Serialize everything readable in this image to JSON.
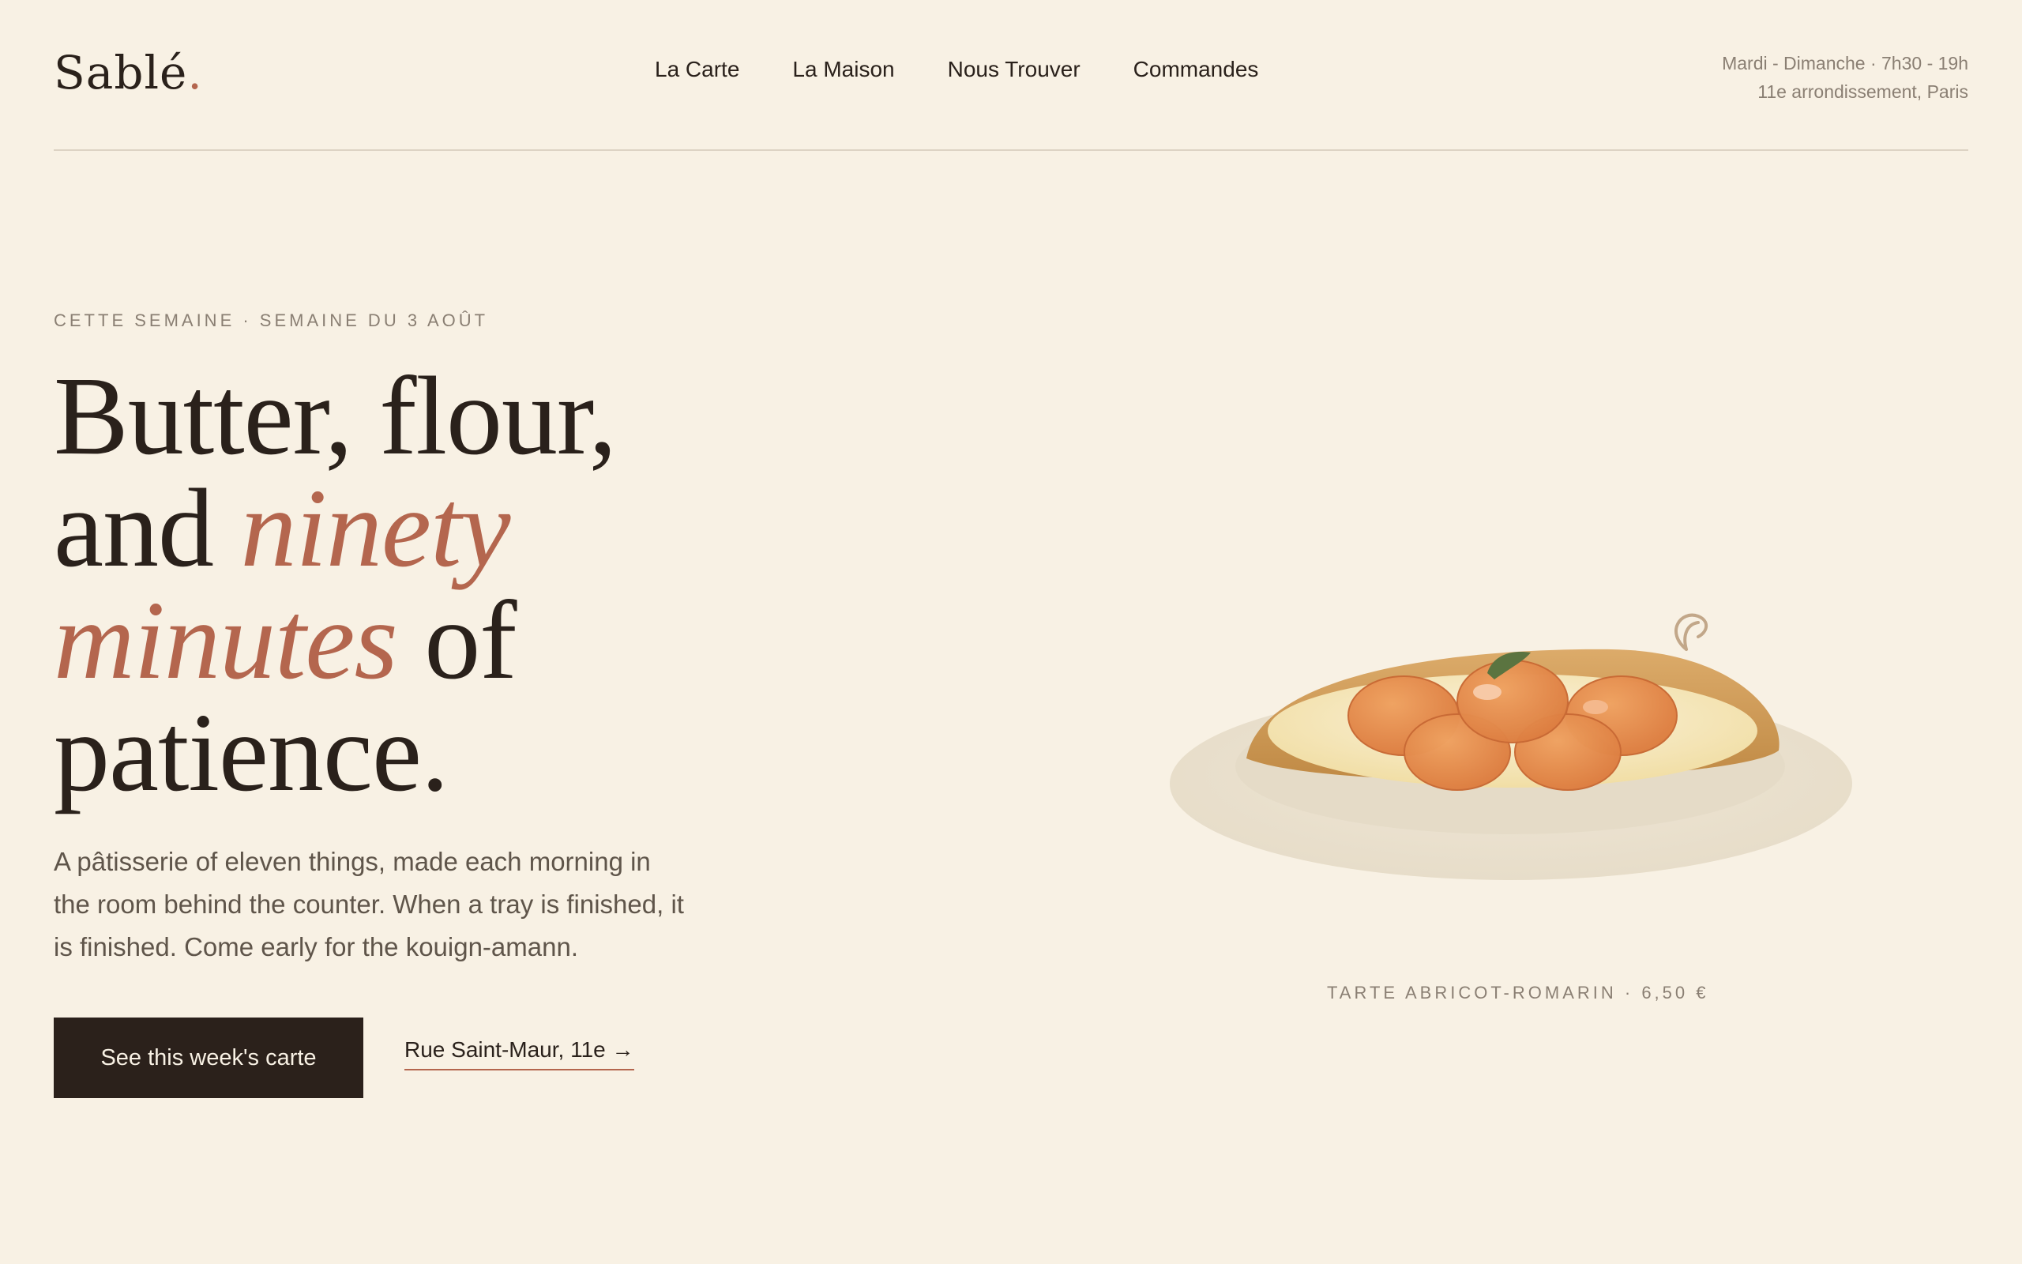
{
  "brand": {
    "name": "Sablé",
    "dot": "."
  },
  "nav": [
    {
      "label": "La Carte"
    },
    {
      "label": "La Maison"
    },
    {
      "label": "Nous Trouver"
    },
    {
      "label": "Commandes"
    }
  ],
  "info": {
    "hours": "Mardi - Dimanche · 7h30 - 19h",
    "location": "11e arrondissement, Paris"
  },
  "hero": {
    "eyebrow": "CETTE SEMAINE · SEMAINE DU 3 AOÛT",
    "headline": {
      "line1": "Butter, flour,",
      "line2_plain": "and ",
      "line2_italic": "ninety",
      "line3_italic": "minutes",
      "line3_plain": " of",
      "line4": "patience."
    },
    "lede": "A pâtisserie of eleven things, made each morning in the room behind the counter. When a tray is finished, it is finished. Come early for the kouign-amann.",
    "cta_label": "See this week's carte",
    "address_link": "Rue Saint-Maur, 11e →"
  },
  "feature": {
    "caption": "TARTE ABRICOT-ROMARIN · 6,50 €",
    "icon": "apricot-tart-illustration"
  },
  "colors": {
    "background": "#f8f1e4",
    "ink": "#2a211b",
    "accent": "#b4664e",
    "muted": "#8a7f73"
  }
}
